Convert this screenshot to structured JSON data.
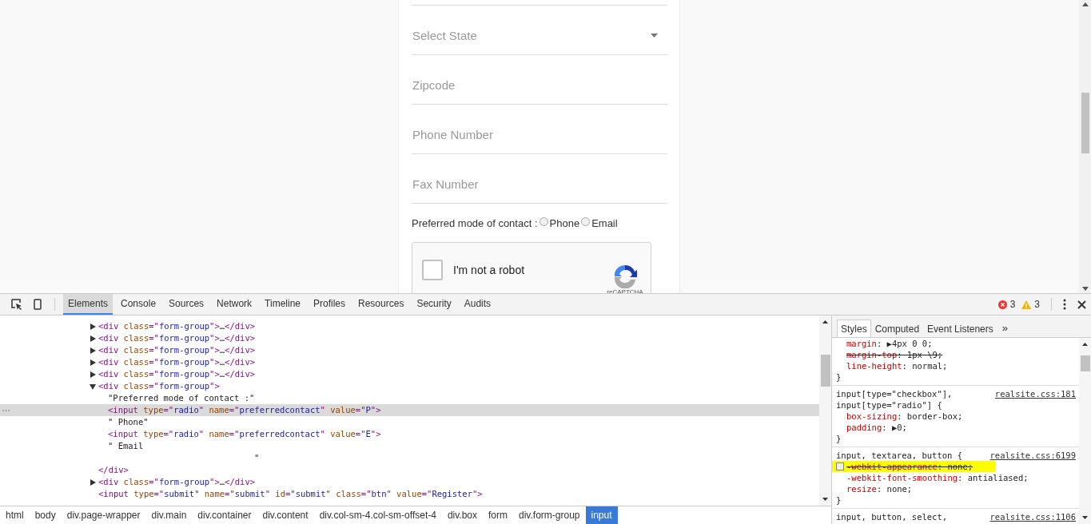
{
  "page": {
    "fields": [
      {
        "kind": "select",
        "placeholder": "Select State"
      },
      {
        "kind": "text",
        "placeholder": "Zipcode"
      },
      {
        "kind": "text",
        "placeholder": "Phone Number"
      },
      {
        "kind": "text",
        "placeholder": "Fax Number"
      }
    ],
    "contact": {
      "label": "Preferred mode of contact :",
      "options": [
        {
          "label": "Phone",
          "checked": false
        },
        {
          "label": "Email",
          "checked": false
        }
      ]
    },
    "captcha": {
      "label": "I'm not a robot",
      "checked": false,
      "brand": "reCAPTCHA"
    }
  },
  "devtools": {
    "tabs": [
      {
        "label": "Elements",
        "selected": true
      },
      {
        "label": "Console",
        "selected": false
      },
      {
        "label": "Sources",
        "selected": false
      },
      {
        "label": "Network",
        "selected": false
      },
      {
        "label": "Timeline",
        "selected": false
      },
      {
        "label": "Profiles",
        "selected": false
      },
      {
        "label": "Resources",
        "selected": false
      },
      {
        "label": "Security",
        "selected": false
      },
      {
        "label": "Audits",
        "selected": false
      }
    ],
    "errors": "3",
    "warnings": "3",
    "dom": [
      {
        "kind": "tag",
        "expanded": false,
        "tokens": [
          {
            "kind": "tag",
            "text": "<div"
          },
          {
            "kind": "attr",
            "text": " class"
          },
          {
            "kind": "tag",
            "text": "=\""
          },
          {
            "kind": "value",
            "text": "form-group"
          },
          {
            "kind": "tag",
            "text": "\">"
          },
          {
            "kind": "text",
            "text": "…"
          },
          {
            "kind": "tag",
            "text": "</div>"
          }
        ]
      },
      {
        "kind": "tag",
        "expanded": false,
        "tokens": [
          {
            "kind": "tag",
            "text": "<div"
          },
          {
            "kind": "attr",
            "text": " class"
          },
          {
            "kind": "tag",
            "text": "=\""
          },
          {
            "kind": "value",
            "text": "form-group"
          },
          {
            "kind": "tag",
            "text": "\">"
          },
          {
            "kind": "text",
            "text": "…"
          },
          {
            "kind": "tag",
            "text": "</div>"
          }
        ]
      },
      {
        "kind": "tag",
        "expanded": false,
        "tokens": [
          {
            "kind": "tag",
            "text": "<div"
          },
          {
            "kind": "attr",
            "text": " class"
          },
          {
            "kind": "tag",
            "text": "=\""
          },
          {
            "kind": "value",
            "text": "form-group"
          },
          {
            "kind": "tag",
            "text": "\">"
          },
          {
            "kind": "text",
            "text": "…"
          },
          {
            "kind": "tag",
            "text": "</div>"
          }
        ]
      },
      {
        "kind": "tag",
        "expanded": false,
        "tokens": [
          {
            "kind": "tag",
            "text": "<div"
          },
          {
            "kind": "attr",
            "text": " class"
          },
          {
            "kind": "tag",
            "text": "=\""
          },
          {
            "kind": "value",
            "text": "form-group"
          },
          {
            "kind": "tag",
            "text": "\">"
          },
          {
            "kind": "text",
            "text": "…"
          },
          {
            "kind": "tag",
            "text": "</div>"
          }
        ]
      },
      {
        "kind": "tag",
        "expanded": false,
        "tokens": [
          {
            "kind": "tag",
            "text": "<div"
          },
          {
            "kind": "attr",
            "text": " class"
          },
          {
            "kind": "tag",
            "text": "=\""
          },
          {
            "kind": "value",
            "text": "form-group"
          },
          {
            "kind": "tag",
            "text": "\">"
          },
          {
            "kind": "text",
            "text": "…"
          },
          {
            "kind": "tag",
            "text": "</div>"
          }
        ]
      },
      {
        "kind": "tag",
        "expanded": true,
        "tokens": [
          {
            "kind": "tag",
            "text": "<div"
          },
          {
            "kind": "attr",
            "text": " class"
          },
          {
            "kind": "tag",
            "text": "=\""
          },
          {
            "kind": "value",
            "text": "form-group"
          },
          {
            "kind": "tag",
            "text": "\">"
          }
        ],
        "close": "</div>",
        "children": [
          {
            "kind": "text",
            "lines": [
              "\"Preferred mode of contact :\""
            ]
          },
          {
            "kind": "leaf",
            "selected": true,
            "tokens": [
              {
                "kind": "tag",
                "text": "<input"
              },
              {
                "kind": "attr",
                "text": " type"
              },
              {
                "kind": "tag",
                "text": "=\""
              },
              {
                "kind": "value",
                "text": "radio"
              },
              {
                "kind": "tag",
                "text": "\""
              },
              {
                "kind": "attr",
                "text": " name"
              },
              {
                "kind": "tag",
                "text": "=\""
              },
              {
                "kind": "value",
                "text": "preferredcontact"
              },
              {
                "kind": "tag",
                "text": "\""
              },
              {
                "kind": "attr",
                "text": " value"
              },
              {
                "kind": "tag",
                "text": "=\""
              },
              {
                "kind": "value",
                "text": "P"
              },
              {
                "kind": "tag",
                "text": "\">"
              }
            ]
          },
          {
            "kind": "text",
            "lines": [
              "\" Phone\""
            ]
          },
          {
            "kind": "leaf",
            "selected": false,
            "tokens": [
              {
                "kind": "tag",
                "text": "<input"
              },
              {
                "kind": "attr",
                "text": " type"
              },
              {
                "kind": "tag",
                "text": "=\""
              },
              {
                "kind": "value",
                "text": "radio"
              },
              {
                "kind": "tag",
                "text": "\""
              },
              {
                "kind": "attr",
                "text": " name"
              },
              {
                "kind": "tag",
                "text": "=\""
              },
              {
                "kind": "value",
                "text": "preferredcontact"
              },
              {
                "kind": "tag",
                "text": "\""
              },
              {
                "kind": "attr",
                "text": " value"
              },
              {
                "kind": "tag",
                "text": "=\""
              },
              {
                "kind": "value",
                "text": "E"
              },
              {
                "kind": "tag",
                "text": "\">"
              }
            ]
          },
          {
            "kind": "text",
            "lines": [
              "\" Email",
              "\""
            ]
          }
        ]
      },
      {
        "kind": "tag",
        "expanded": false,
        "tokens": [
          {
            "kind": "tag",
            "text": "<div"
          },
          {
            "kind": "attr",
            "text": " class"
          },
          {
            "kind": "tag",
            "text": "=\""
          },
          {
            "kind": "value",
            "text": "form-group"
          },
          {
            "kind": "tag",
            "text": "\">"
          },
          {
            "kind": "text",
            "text": "…"
          },
          {
            "kind": "tag",
            "text": "</div>"
          }
        ]
      },
      {
        "kind": "leaf",
        "selected": false,
        "tokens": [
          {
            "kind": "tag",
            "text": "<input"
          },
          {
            "kind": "attr",
            "text": " type"
          },
          {
            "kind": "tag",
            "text": "=\""
          },
          {
            "kind": "value",
            "text": "submit"
          },
          {
            "kind": "tag",
            "text": "\""
          },
          {
            "kind": "attr",
            "text": " name"
          },
          {
            "kind": "tag",
            "text": "=\""
          },
          {
            "kind": "value",
            "text": "submit"
          },
          {
            "kind": "tag",
            "text": "\""
          },
          {
            "kind": "attr",
            "text": " id"
          },
          {
            "kind": "tag",
            "text": "=\""
          },
          {
            "kind": "value",
            "text": "submit"
          },
          {
            "kind": "tag",
            "text": "\""
          },
          {
            "kind": "attr",
            "text": " class"
          },
          {
            "kind": "tag",
            "text": "=\""
          },
          {
            "kind": "value",
            "text": "btn"
          },
          {
            "kind": "tag",
            "text": "\""
          },
          {
            "kind": "attr",
            "text": " value"
          },
          {
            "kind": "tag",
            "text": "=\""
          },
          {
            "kind": "value",
            "text": "Register"
          },
          {
            "kind": "tag",
            "text": "\">"
          }
        ]
      }
    ],
    "breadcrumbs": [
      {
        "label": "html",
        "selected": false
      },
      {
        "label": "body",
        "selected": false
      },
      {
        "label": "div.page-wrapper",
        "selected": false
      },
      {
        "label": "div.main",
        "selected": false
      },
      {
        "label": "div.container",
        "selected": false
      },
      {
        "label": "div.content",
        "selected": false
      },
      {
        "label": "div.col-sm-4.col-sm-offset-4",
        "selected": false
      },
      {
        "label": "div.box",
        "selected": false
      },
      {
        "label": "form",
        "selected": false
      },
      {
        "label": "div.form-group",
        "selected": false
      },
      {
        "label": "input",
        "selected": true
      }
    ],
    "side_tabs": [
      {
        "label": "Styles",
        "selected": true
      },
      {
        "label": "Computed",
        "selected": false
      },
      {
        "label": "Event Listeners",
        "selected": false
      }
    ],
    "more": "»",
    "rules": [
      {
        "close": "}",
        "props": [
          {
            "name": "margin",
            "value": ": ▶4px 0 0;",
            "struck": false
          },
          {
            "name": "margin-top",
            "value": ": 1px \\9;",
            "struck": true
          },
          {
            "name": "line-height",
            "value": ": normal;",
            "struck": false
          }
        ]
      },
      {
        "selectors": [
          "input[type=\"checkbox\"],",
          "input[type=\"radio\"] {"
        ],
        "source": "realsite.css:181",
        "close": "}",
        "props": [
          {
            "name": "box-sizing",
            "value": ": border-box;",
            "struck": false
          },
          {
            "name": "padding",
            "value": ": ▶0;",
            "struck": false
          }
        ]
      },
      {
        "selectors": [
          "input, textarea, button {"
        ],
        "source": "realsite.css:6199",
        "close": "}",
        "props": [
          {
            "name": "-webkit-appearance",
            "value": ": none;",
            "struck": true,
            "checkbox": true,
            "highlighted": true
          },
          {
            "name": "-webkit-font-smoothing",
            "value": ": antialiased;",
            "struck": false
          },
          {
            "name": "resize",
            "value": ": none;",
            "struck": false
          }
        ]
      },
      {
        "selectors": [
          "input, button, select,"
        ],
        "source": "realsite.css:1106"
      }
    ]
  }
}
